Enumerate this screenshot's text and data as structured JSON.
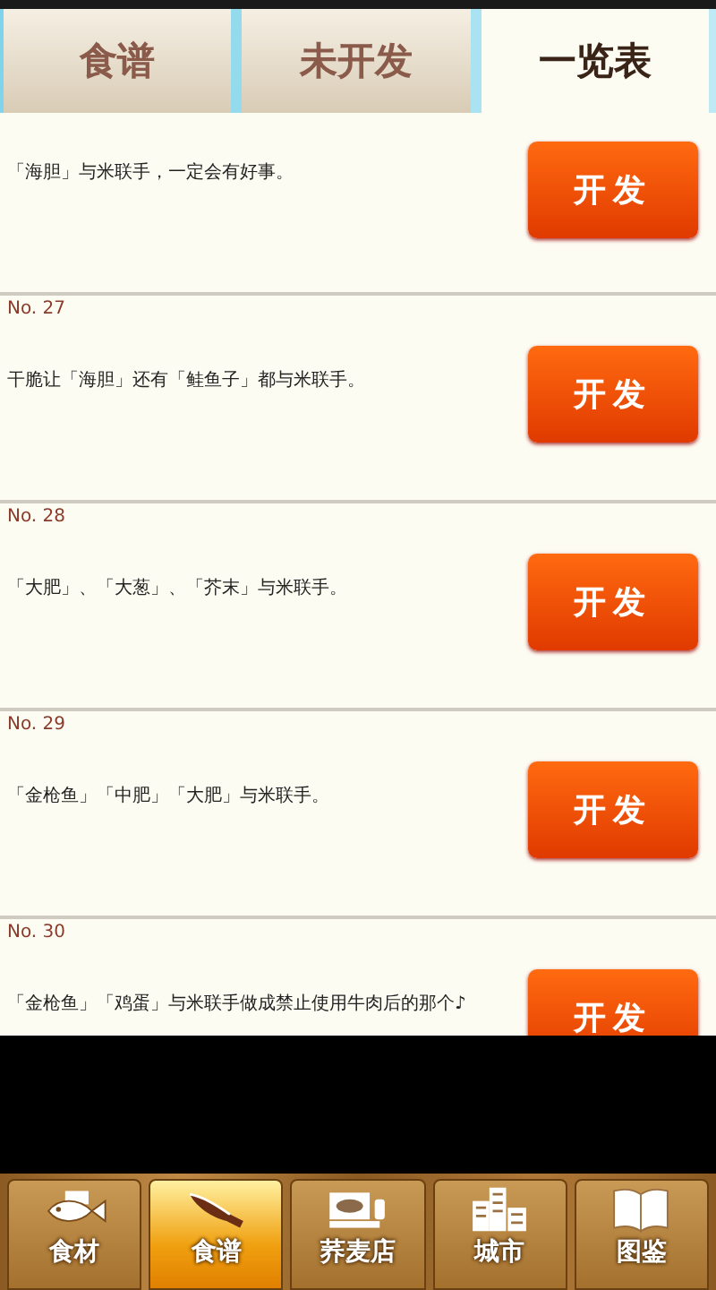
{
  "tabs": [
    {
      "label": "食谱",
      "selected": false
    },
    {
      "label": "未开发",
      "selected": false
    },
    {
      "label": "一览表",
      "selected": true
    }
  ],
  "entries": [
    {
      "text": "「海胆」与米联手，一定会有好事。",
      "action": "开发"
    },
    {
      "number": "No. 27",
      "text": "干脆让「海胆」还有「鲑鱼子」都与米联手。",
      "action": "开发"
    },
    {
      "number": "No. 28",
      "text": "「大肥」、「大葱」、「芥末」与米联手。",
      "action": "开发"
    },
    {
      "number": "No. 29",
      "text": "「金枪鱼」「中肥」「大肥」与米联手。",
      "action": "开发"
    },
    {
      "number": "No. 30",
      "text": "「金枪鱼」「鸡蛋」与米联手做成禁止使用牛肉后的那个♪",
      "action": "开发"
    }
  ],
  "nav": [
    {
      "label": "食材",
      "kind": "fish",
      "selected": false
    },
    {
      "label": "食谱",
      "kind": "knife",
      "selected": true
    },
    {
      "label": "荞麦店",
      "kind": "shop",
      "selected": false
    },
    {
      "label": "城市",
      "kind": "city",
      "selected": false
    },
    {
      "label": "图鉴",
      "kind": "book",
      "selected": false
    }
  ]
}
